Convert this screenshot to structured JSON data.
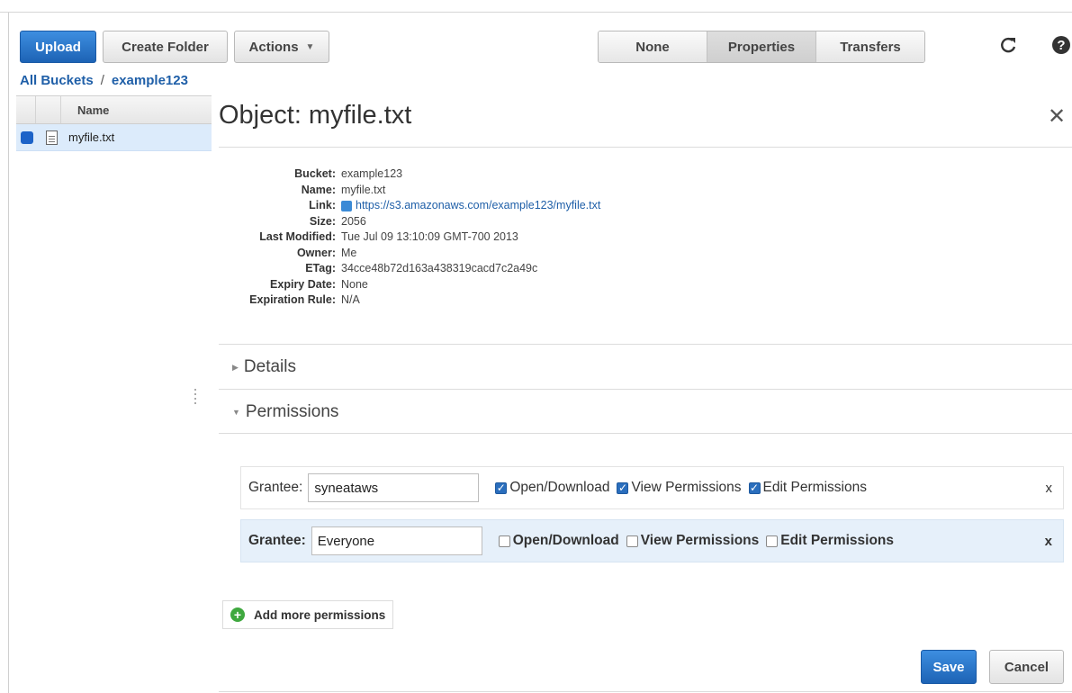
{
  "toolbar": {
    "upload_label": "Upload",
    "create_folder_label": "Create Folder",
    "actions_label": "Actions",
    "view_tabs": [
      "None",
      "Properties",
      "Transfers"
    ],
    "active_tab": "Properties",
    "refresh_icon": "refresh-icon",
    "help_icon": "help-icon"
  },
  "breadcrumb": {
    "root": "All Buckets",
    "separator": "/",
    "bucket": "example123"
  },
  "file_list": {
    "column_header": "Name",
    "items": [
      {
        "name": "myfile.txt",
        "selected": true
      }
    ]
  },
  "object": {
    "title": "Object: myfile.txt",
    "properties": [
      {
        "label": "Bucket:",
        "value": "example123"
      },
      {
        "label": "Name:",
        "value": "myfile.txt"
      },
      {
        "label": "Link:",
        "value": "https://s3.amazonaws.com/example123/myfile.txt",
        "is_link": true
      },
      {
        "label": "Size:",
        "value": "2056"
      },
      {
        "label": "Last Modified:",
        "value": "Tue Jul 09 13:10:09 GMT-700 2013"
      },
      {
        "label": "Owner:",
        "value": "Me"
      },
      {
        "label": "ETag:",
        "value": "34cce48b72d163a438319cacd7c2a49c"
      },
      {
        "label": "Expiry Date:",
        "value": "None"
      },
      {
        "label": "Expiration Rule:",
        "value": "N/A"
      }
    ]
  },
  "sections": {
    "details": "Details",
    "permissions": "Permissions"
  },
  "permissions": {
    "grantee_label": "Grantee:",
    "option_labels": [
      "Open/Download",
      "View Permissions",
      "Edit Permissions"
    ],
    "rows": [
      {
        "grantee": "syneataws",
        "open_download": true,
        "view_permissions": true,
        "edit_permissions": true
      },
      {
        "grantee": "Everyone",
        "open_download": false,
        "view_permissions": false,
        "edit_permissions": false
      }
    ],
    "remove_label": "x",
    "add_more_label": "Add more permissions"
  },
  "footer": {
    "save_label": "Save",
    "cancel_label": "Cancel"
  },
  "colors": {
    "primary_blue": "#2a6ebd",
    "link_blue": "#1f5fa8",
    "selected_row": "#dcebfb",
    "add_green": "#3fa83f"
  }
}
